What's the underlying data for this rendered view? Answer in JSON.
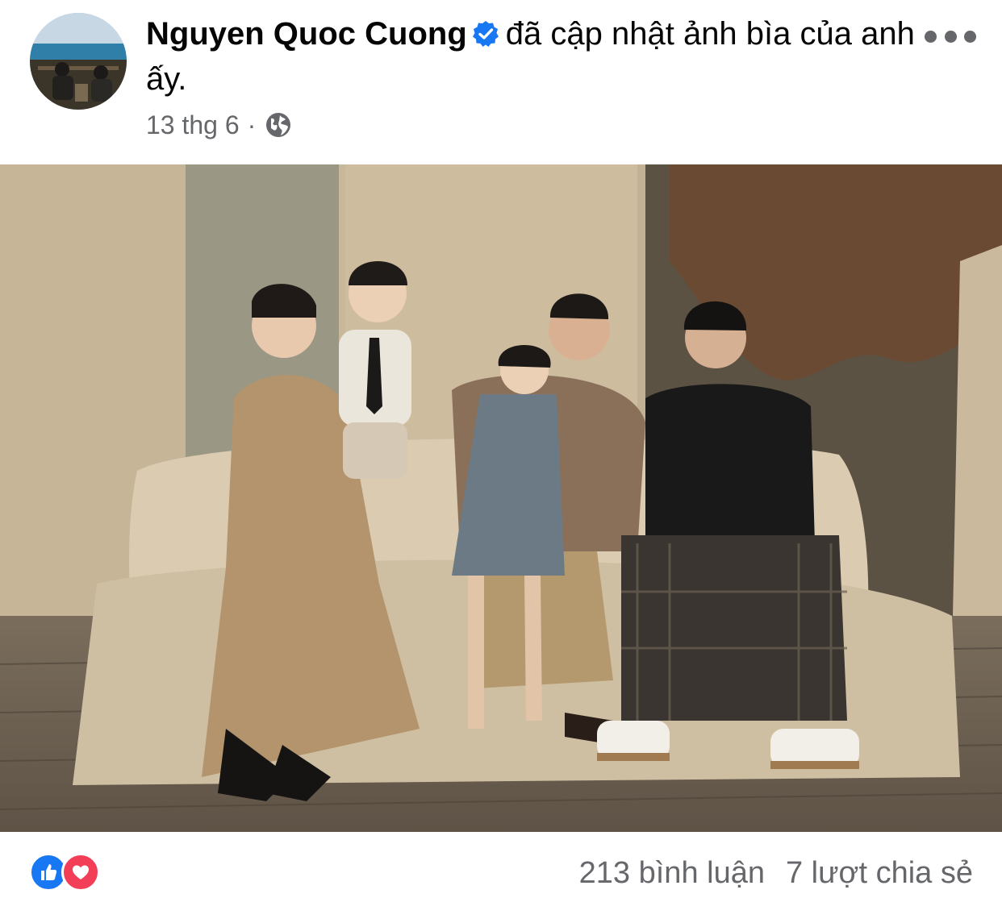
{
  "post": {
    "author": "Nguyen Quoc Cuong",
    "action_text": "đã cập nhật ảnh bìa của anh ấy.",
    "date": "13 thg 6",
    "separator": "·",
    "privacy_icon": "globe-icon",
    "verified_icon": "verified-badge-icon",
    "more_icon": "more-options-icon"
  },
  "footer": {
    "reactions": [
      "like-icon",
      "love-icon"
    ],
    "comments": "213 bình luận",
    "shares": "7 lượt chia sẻ"
  },
  "colors": {
    "brand_blue": "#1877f2",
    "love_red": "#f33e58",
    "secondary_text": "#65676b"
  }
}
